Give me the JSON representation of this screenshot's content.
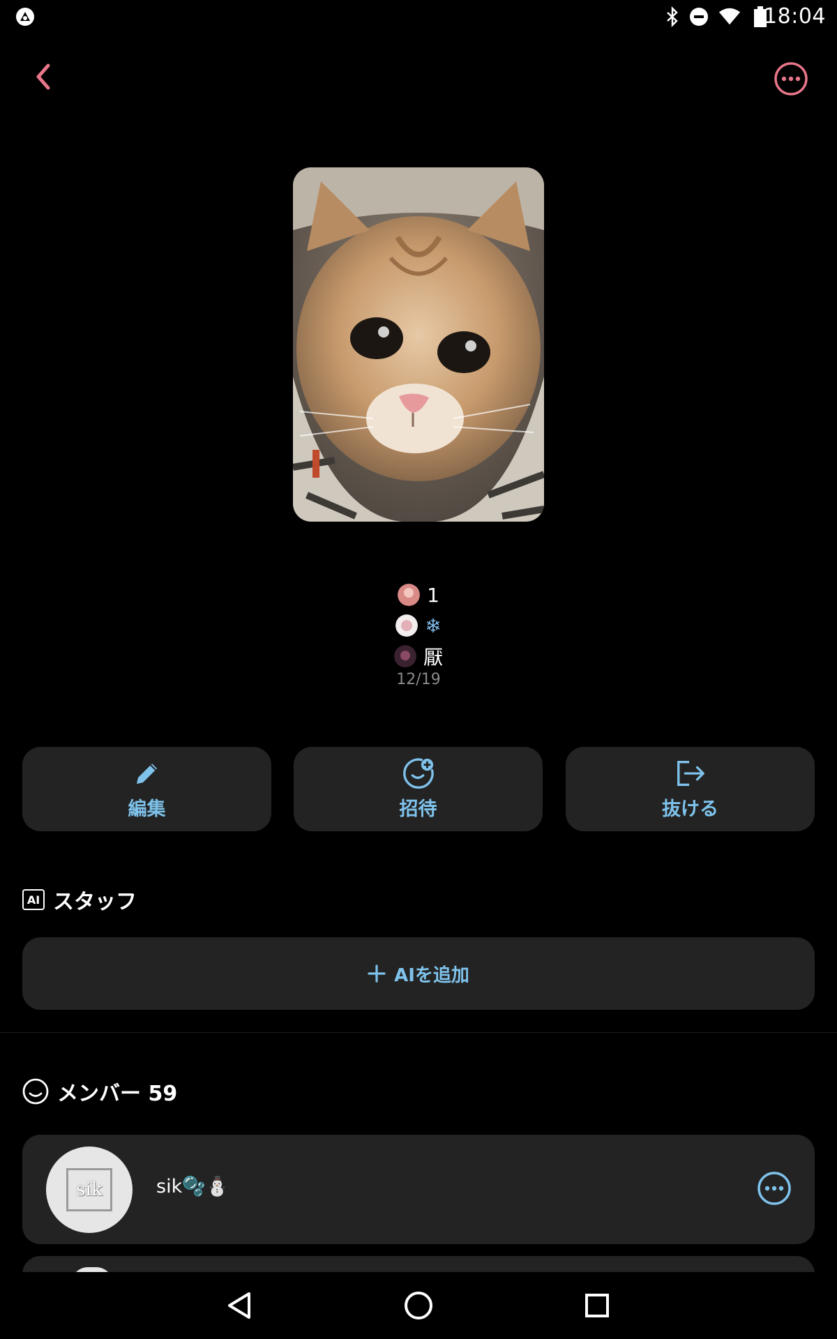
{
  "status_bar": {
    "time": "18:04",
    "icons": [
      "app-logo-icon",
      "bluetooth-icon",
      "do-not-disturb-icon",
      "wifi-icon",
      "battery-icon"
    ]
  },
  "header": {
    "back_icon": "chevron-left-icon",
    "more_icon": "more-horizontal-icon",
    "accent_color": "#e8768a"
  },
  "group": {
    "member_names": [
      "1",
      "❄",
      "厭"
    ],
    "date": "12/19"
  },
  "actions": [
    {
      "label": "編集",
      "icon": "pencil-icon"
    },
    {
      "label": "招待",
      "icon": "add-person-icon"
    },
    {
      "label": "抜ける",
      "icon": "exit-icon"
    }
  ],
  "staff_section": {
    "badge": "AI",
    "title": "スタッフ",
    "add_button_label": "AIを追加"
  },
  "members_section": {
    "title": "メンバー 59",
    "members": [
      {
        "name": "sik🫧⛄",
        "avatar_text": "sik"
      }
    ]
  },
  "colors": {
    "accent_blue": "#7fc3ec",
    "card_bg": "#232323"
  }
}
